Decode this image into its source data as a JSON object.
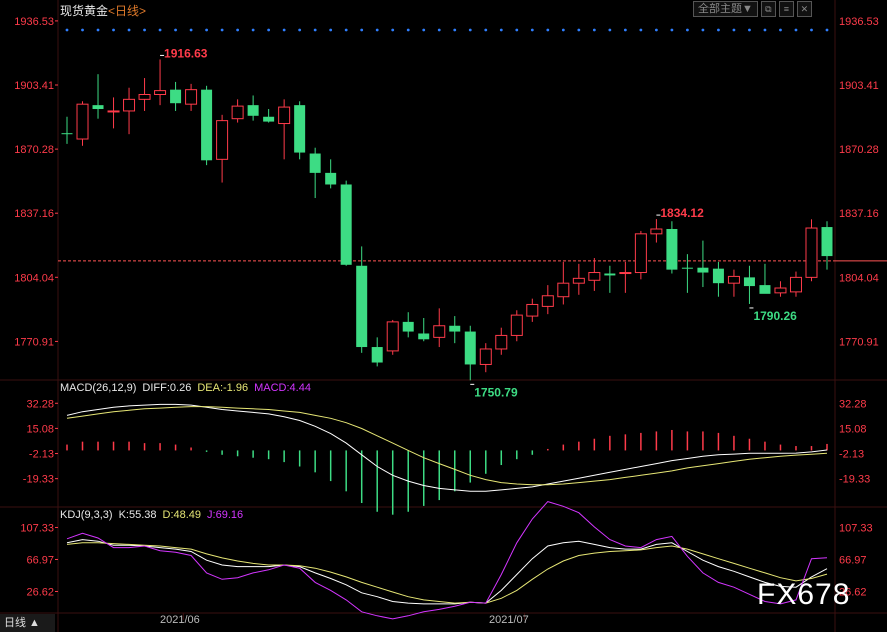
{
  "header": {
    "symbol": "现货黄金",
    "period": "<日线>",
    "dropdown_label": "全部主题▼"
  },
  "colors": {
    "up": "#ff3b4a",
    "down": "#3ddc84",
    "grid": "#3a1010",
    "dot": "#2f7fff",
    "diff": "#ffffff",
    "dea": "#e6e675",
    "macd": "#d335ff",
    "price_line": "#ff5555"
  },
  "chart_data": [
    {
      "type": "candlestick",
      "title": "现货黄金 日线",
      "y_ticks": [
        1936.53,
        1903.41,
        1870.28,
        1837.16,
        1804.04,
        1770.91
      ],
      "ylim": [
        1752,
        1937
      ],
      "current_price": 1812.5,
      "annotations": [
        {
          "text": "1916.63",
          "index": 6,
          "value": 1916.63,
          "kind": "high"
        },
        {
          "text": "1750.79",
          "index": 26,
          "value": 1750.79,
          "kind": "low"
        },
        {
          "text": "1834.12",
          "index": 38,
          "value": 1834.12,
          "kind": "high"
        },
        {
          "text": "1790.26",
          "index": 44,
          "value": 1790.26,
          "kind": "low"
        }
      ],
      "candles": [
        {
          "o": 1878.5,
          "h": 1887.0,
          "l": 1873.0,
          "c": 1878.0
        },
        {
          "o": 1875.5,
          "h": 1895.0,
          "l": 1872.0,
          "c": 1893.5
        },
        {
          "o": 1893.0,
          "h": 1909.0,
          "l": 1886.0,
          "c": 1891.0
        },
        {
          "o": 1889.5,
          "h": 1897.0,
          "l": 1881.0,
          "c": 1890.0
        },
        {
          "o": 1890.0,
          "h": 1902.0,
          "l": 1878.0,
          "c": 1896.0
        },
        {
          "o": 1896.0,
          "h": 1907.0,
          "l": 1890.0,
          "c": 1898.5
        },
        {
          "o": 1898.5,
          "h": 1916.63,
          "l": 1893.0,
          "c": 1900.5
        },
        {
          "o": 1901.0,
          "h": 1905.0,
          "l": 1890.0,
          "c": 1894.0
        },
        {
          "o": 1893.5,
          "h": 1904.0,
          "l": 1890.0,
          "c": 1901.0
        },
        {
          "o": 1901.0,
          "h": 1903.0,
          "l": 1862.0,
          "c": 1864.5
        },
        {
          "o": 1865.0,
          "h": 1888.0,
          "l": 1853.0,
          "c": 1885.0
        },
        {
          "o": 1886.0,
          "h": 1896.0,
          "l": 1884.0,
          "c": 1892.5
        },
        {
          "o": 1893.0,
          "h": 1898.0,
          "l": 1885.0,
          "c": 1887.5
        },
        {
          "o": 1887.0,
          "h": 1891.0,
          "l": 1884.0,
          "c": 1884.5
        },
        {
          "o": 1883.5,
          "h": 1896.0,
          "l": 1865.0,
          "c": 1892.0
        },
        {
          "o": 1893.0,
          "h": 1895.0,
          "l": 1865.0,
          "c": 1868.5
        },
        {
          "o": 1868.0,
          "h": 1871.0,
          "l": 1845.0,
          "c": 1858.0
        },
        {
          "o": 1858.0,
          "h": 1865.0,
          "l": 1850.0,
          "c": 1852.0
        },
        {
          "o": 1852.0,
          "h": 1854.0,
          "l": 1810.0,
          "c": 1810.5
        },
        {
          "o": 1810.0,
          "h": 1820.0,
          "l": 1765.0,
          "c": 1768.0
        },
        {
          "o": 1768.0,
          "h": 1773.0,
          "l": 1758.0,
          "c": 1760.0
        },
        {
          "o": 1766.0,
          "h": 1782.0,
          "l": 1764.0,
          "c": 1781.0
        },
        {
          "o": 1781.0,
          "h": 1786.0,
          "l": 1773.0,
          "c": 1776.0
        },
        {
          "o": 1775.0,
          "h": 1783.0,
          "l": 1771.0,
          "c": 1772.0
        },
        {
          "o": 1773.0,
          "h": 1788.0,
          "l": 1768.0,
          "c": 1779.0
        },
        {
          "o": 1779.0,
          "h": 1784.0,
          "l": 1770.0,
          "c": 1776.0
        },
        {
          "o": 1776.0,
          "h": 1779.0,
          "l": 1750.79,
          "c": 1759.0
        },
        {
          "o": 1759.0,
          "h": 1770.0,
          "l": 1755.0,
          "c": 1767.0
        },
        {
          "o": 1767.0,
          "h": 1778.0,
          "l": 1764.0,
          "c": 1774.0
        },
        {
          "o": 1774.0,
          "h": 1787.0,
          "l": 1771.0,
          "c": 1784.5
        },
        {
          "o": 1784.0,
          "h": 1793.0,
          "l": 1781.0,
          "c": 1790.0
        },
        {
          "o": 1789.0,
          "h": 1800.0,
          "l": 1785.0,
          "c": 1794.5
        },
        {
          "o": 1794.0,
          "h": 1812.0,
          "l": 1790.0,
          "c": 1801.0
        },
        {
          "o": 1801.0,
          "h": 1811.0,
          "l": 1795.0,
          "c": 1803.5
        },
        {
          "o": 1802.5,
          "h": 1814.0,
          "l": 1797.0,
          "c": 1806.5
        },
        {
          "o": 1806.0,
          "h": 1810.0,
          "l": 1796.0,
          "c": 1805.0
        },
        {
          "o": 1806.0,
          "h": 1812.0,
          "l": 1796.0,
          "c": 1806.5
        },
        {
          "o": 1806.5,
          "h": 1828.0,
          "l": 1803.0,
          "c": 1826.5
        },
        {
          "o": 1826.5,
          "h": 1834.12,
          "l": 1822.0,
          "c": 1829.0
        },
        {
          "o": 1829.0,
          "h": 1833.0,
          "l": 1806.0,
          "c": 1808.0
        },
        {
          "o": 1809.0,
          "h": 1816.0,
          "l": 1796.0,
          "c": 1808.5
        },
        {
          "o": 1809.0,
          "h": 1823.0,
          "l": 1799.0,
          "c": 1806.5
        },
        {
          "o": 1808.5,
          "h": 1812.0,
          "l": 1794.0,
          "c": 1801.0
        },
        {
          "o": 1801.0,
          "h": 1808.0,
          "l": 1794.0,
          "c": 1804.5
        },
        {
          "o": 1804.0,
          "h": 1810.0,
          "l": 1790.26,
          "c": 1799.5
        },
        {
          "o": 1800.0,
          "h": 1811.0,
          "l": 1796.0,
          "c": 1795.5
        },
        {
          "o": 1796.0,
          "h": 1802.0,
          "l": 1794.0,
          "c": 1798.5
        },
        {
          "o": 1796.5,
          "h": 1807.0,
          "l": 1794.0,
          "c": 1804.0
        },
        {
          "o": 1804.0,
          "h": 1834.0,
          "l": 1802.0,
          "c": 1829.5
        },
        {
          "o": 1830.0,
          "h": 1833.0,
          "l": 1808.0,
          "c": 1815.0
        }
      ],
      "x_tick_labels": [
        {
          "index": 8,
          "label": "2021/06"
        },
        {
          "index": 30,
          "label": "2021/07"
        }
      ]
    },
    {
      "type": "line",
      "title": "MACD(26,12,9)",
      "legend": {
        "name": "MACD(26,12,9)",
        "diff": "DIFF:0.26",
        "dea": "DEA:-1.96",
        "macd": "MACD:4.44"
      },
      "y_ticks": [
        32.28,
        15.08,
        -2.13,
        -19.33
      ],
      "ylim": [
        -36,
        40
      ],
      "series": [
        {
          "name": "DIFF",
          "values": [
            24,
            26.5,
            28,
            29.5,
            30.5,
            31,
            31.5,
            31.5,
            31,
            29.5,
            28,
            27,
            26,
            25,
            23,
            20.5,
            16.5,
            11.5,
            5,
            -3,
            -11,
            -17,
            -21,
            -24,
            -26,
            -27,
            -28,
            -28,
            -27,
            -26,
            -25,
            -23,
            -21,
            -19,
            -17,
            -15,
            -13,
            -11,
            -9,
            -7,
            -5.5,
            -4,
            -3,
            -2.5,
            -2,
            -2,
            -2,
            -1.8,
            -1,
            0.26
          ]
        },
        {
          "name": "DEA",
          "values": [
            22,
            23.5,
            25,
            26.5,
            27.5,
            28.5,
            29,
            29.5,
            30,
            30,
            29.5,
            29,
            28.5,
            28,
            27,
            26,
            24,
            22,
            19,
            15,
            10,
            5,
            0,
            -5,
            -9,
            -13,
            -17,
            -20,
            -22,
            -23,
            -23.5,
            -23.5,
            -23,
            -22,
            -21,
            -20,
            -18.5,
            -17,
            -15.5,
            -14,
            -12,
            -10.5,
            -9,
            -7.5,
            -6,
            -5,
            -4,
            -3.2,
            -2.6,
            -1.96
          ]
        },
        {
          "name": "MACD",
          "values": [
            4,
            6,
            6,
            6,
            6,
            5,
            5,
            4,
            2,
            -1,
            -3,
            -4,
            -5,
            -6,
            -8,
            -11,
            -15,
            -21,
            -28,
            -36,
            -42,
            -44,
            -42,
            -38,
            -34,
            -28,
            -22,
            -16,
            -10,
            -6,
            -3,
            1,
            4,
            6,
            8,
            10,
            11,
            12,
            13,
            14,
            13,
            13,
            12,
            10,
            8,
            6,
            4,
            3,
            3,
            4.44
          ]
        }
      ]
    },
    {
      "type": "line",
      "title": "KDJ(9,3,3)",
      "legend": {
        "name": "KDJ(9,3,3)",
        "k": "K:55.38",
        "d": "D:48.49",
        "j": "J:69.16"
      },
      "y_ticks": [
        107.33,
        66.97,
        26.62
      ],
      "ylim": [
        2,
        118
      ],
      "series": [
        {
          "name": "K",
          "values": [
            88,
            92,
            90,
            85,
            85,
            84,
            82,
            80,
            77,
            66,
            60,
            58,
            58,
            58,
            60,
            58,
            50,
            43,
            35,
            25,
            20,
            14,
            12,
            11,
            11,
            11,
            13,
            12,
            28,
            48,
            68,
            84,
            88,
            90,
            86,
            82,
            80,
            80,
            86,
            88,
            77,
            66,
            58,
            52,
            45,
            38,
            33,
            32,
            45,
            55.38
          ]
        },
        {
          "name": "D",
          "values": [
            86,
            88,
            88,
            87,
            86,
            85,
            84,
            82,
            80,
            74,
            69,
            65,
            62,
            60,
            60,
            59,
            56,
            51,
            45,
            38,
            32,
            26,
            20,
            16,
            14,
            12,
            13,
            12,
            18,
            28,
            42,
            55,
            65,
            72,
            75,
            77,
            78,
            79,
            82,
            84,
            80,
            74,
            68,
            62,
            56,
            50,
            44,
            40,
            43,
            48.49
          ]
        },
        {
          "name": "J",
          "values": [
            93,
            100,
            94,
            82,
            82,
            84,
            78,
            76,
            72,
            50,
            42,
            44,
            50,
            54,
            60,
            56,
            38,
            28,
            16,
            1,
            -4,
            -8,
            -4,
            1,
            4,
            8,
            13,
            12,
            48,
            88,
            118,
            140,
            134,
            126,
            108,
            92,
            84,
            82,
            92,
            96,
            71,
            50,
            38,
            32,
            23,
            14,
            11,
            16,
            68,
            69.16
          ]
        }
      ]
    }
  ],
  "x_axis": {
    "labels": [
      "2021/06",
      "2021/07"
    ]
  },
  "footer": {
    "tab": "日线 ▲"
  },
  "watermark": "FX678"
}
